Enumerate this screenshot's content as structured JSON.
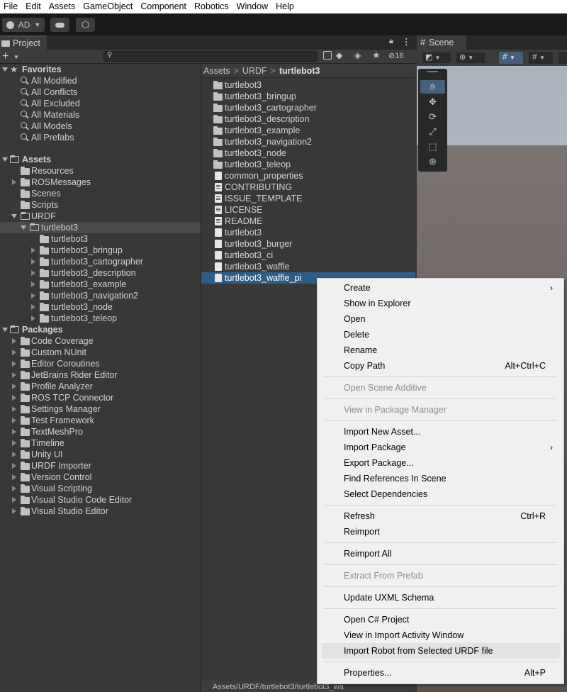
{
  "menubar": {
    "items": [
      "File",
      "Edit",
      "Assets",
      "GameObject",
      "Component",
      "Robotics",
      "Window",
      "Help"
    ]
  },
  "toolbar": {
    "account_label": "AD"
  },
  "project": {
    "tab_label": "Project",
    "hidden_count": "16",
    "favorites": {
      "header": "Favorites",
      "items": [
        "All Modified",
        "All Conflicts",
        "All Excluded",
        "All Materials",
        "All Models",
        "All Prefabs"
      ]
    },
    "assets": {
      "header": "Assets",
      "items": [
        "Resources",
        "ROSMessages",
        "Scenes",
        "Scripts",
        "URDF"
      ],
      "turtlebot_root": "turtlebot3",
      "turtlebot_children": [
        "turtlebot3",
        "turtlebot3_bringup",
        "turtlebot3_cartographer",
        "turtlebot3_description",
        "turtlebot3_example",
        "turtlebot3_navigation2",
        "turtlebot3_node",
        "turtlebot3_teleop"
      ]
    },
    "packages": {
      "header": "Packages",
      "items": [
        "Code Coverage",
        "Custom NUnit",
        "Editor Coroutines",
        "JetBrains Rider Editor",
        "Profile Analyzer",
        "ROS TCP Connector",
        "Settings Manager",
        "Test Framework",
        "TextMeshPro",
        "Timeline",
        "Unity UI",
        "URDF Importer",
        "Version Control",
        "Visual Scripting",
        "Visual Studio Code Editor",
        "Visual Studio Editor"
      ]
    }
  },
  "breadcrumb": {
    "parts": [
      "Assets",
      "URDF",
      "turtlebot3"
    ]
  },
  "files": {
    "folders": [
      "turtlebot3",
      "turtlebot3_bringup",
      "turtlebot3_cartographer",
      "turtlebot3_description",
      "turtlebot3_example",
      "turtlebot3_navigation2",
      "turtlebot3_node",
      "turtlebot3_teleop"
    ],
    "documents": [
      "common_properties",
      "CONTRIBUTING",
      "ISSUE_TEMPLATE",
      "LICENSE",
      "README",
      "turtlebot3",
      "turtlebot3_burger",
      "turtlebot3_ci",
      "turtlebot3_waffle",
      "turtlebot3_waffle_pi"
    ]
  },
  "status_path": "Assets/URDF/turtlebot3/turtlebot3_wa",
  "scene": {
    "tab_label": "Scene"
  },
  "context_menu": {
    "create": "Create",
    "show_in_explorer": "Show in Explorer",
    "open": "Open",
    "delete": "Delete",
    "rename": "Rename",
    "copy_path": "Copy Path",
    "copy_path_shortcut": "Alt+Ctrl+C",
    "open_scene_additive": "Open Scene Additive",
    "view_in_package_manager": "View in Package Manager",
    "import_new_asset": "Import New Asset...",
    "import_package": "Import Package",
    "export_package": "Export Package...",
    "find_references": "Find References In Scene",
    "select_dependencies": "Select Dependencies",
    "refresh": "Refresh",
    "refresh_shortcut": "Ctrl+R",
    "reimport": "Reimport",
    "reimport_all": "Reimport All",
    "extract_from_prefab": "Extract From Prefab",
    "update_uxml": "Update UXML Schema",
    "open_csharp": "Open C# Project",
    "view_import_activity": "View in Import Activity Window",
    "import_robot": "Import Robot from Selected URDF file",
    "properties": "Properties...",
    "properties_shortcut": "Alt+P"
  }
}
